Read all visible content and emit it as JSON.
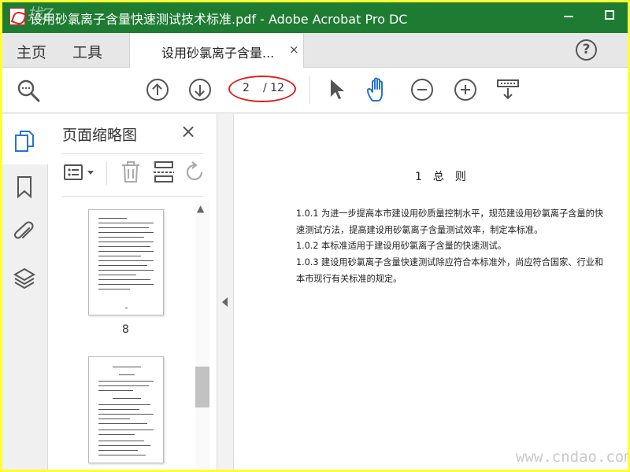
{
  "window": {
    "title": "设用砂氯离子含量快速测试技术标准.pdf - Adobe Acrobat Pro DC",
    "top_watermark": "找Z"
  },
  "menu": {
    "home": "主页",
    "tools": "工具",
    "tab_label": "设用砂氯离子含量...",
    "tab_close": "×",
    "help": "?"
  },
  "toolbar": {
    "current_page": "2",
    "total_pages": "/ 12"
  },
  "thumbnails": {
    "title": "页面缩略图",
    "close": "×",
    "page_number": "8"
  },
  "document": {
    "heading": "1　总　则",
    "lines": [
      "1.0.1 为进一步提高本市建设用砂质量控制水平，规范建设用砂氯离子含量的快",
      "速测试方法，提高建设用砂氯离子含量测试效率，制定本标准。",
      "1.0.2 本标准适用于建设用砂氯离子含量的快速测试。",
      "1.0.3 建设用砂氯离子含量快速测试除应符合本标准外，尚应符合国家、行业和",
      "本市现行有关标准的规定。"
    ]
  },
  "watermark": "www.cndao.com",
  "colors": {
    "titlebar": "#1e7b32",
    "frame": "#ffff33",
    "page_circle": "#e02020",
    "hand_tool": "#2a73c9"
  },
  "icons": {
    "search": "search-icon",
    "prev": "arrow-up-icon",
    "next": "arrow-down-icon",
    "select": "cursor-icon",
    "hand": "hand-icon",
    "zoom_out": "zoom-out-icon",
    "zoom_in": "zoom-in-icon",
    "fit": "fit-page-icon"
  }
}
